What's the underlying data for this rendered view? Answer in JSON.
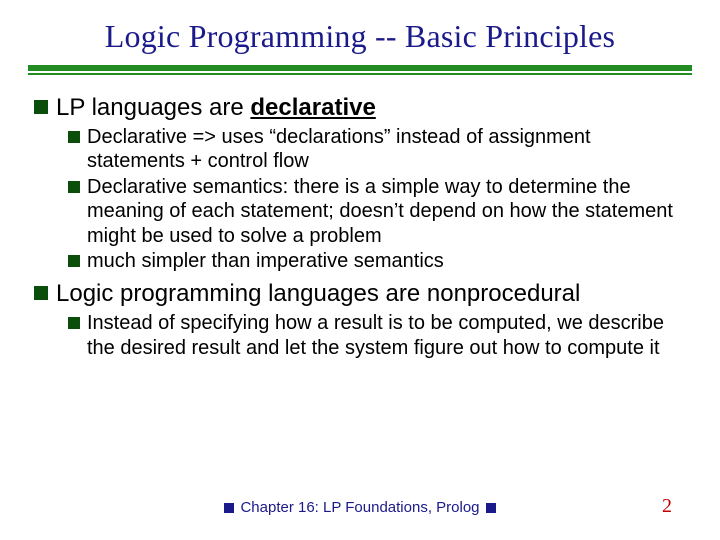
{
  "title": "Logic Programming -- Basic Principles",
  "items": [
    {
      "text_pre": "LP languages are ",
      "text_em": "declarative",
      "sub": [
        "Declarative => uses “declarations” instead of assignment statements + control flow",
        "Declarative semantics:  there is a simple way to determine the meaning of each statement; doesn’t depend on how the statement might be used to solve a problem",
        "much simpler than imperative semantics"
      ]
    },
    {
      "text_pre": "Logic programming languages are nonprocedural",
      "text_em": "",
      "sub": [
        "Instead of specifying how a result is to be computed, we describe the desired result and let the system figure out how to compute it"
      ]
    }
  ],
  "footer": "Chapter 16: LP Foundations, Prolog",
  "page": "2"
}
